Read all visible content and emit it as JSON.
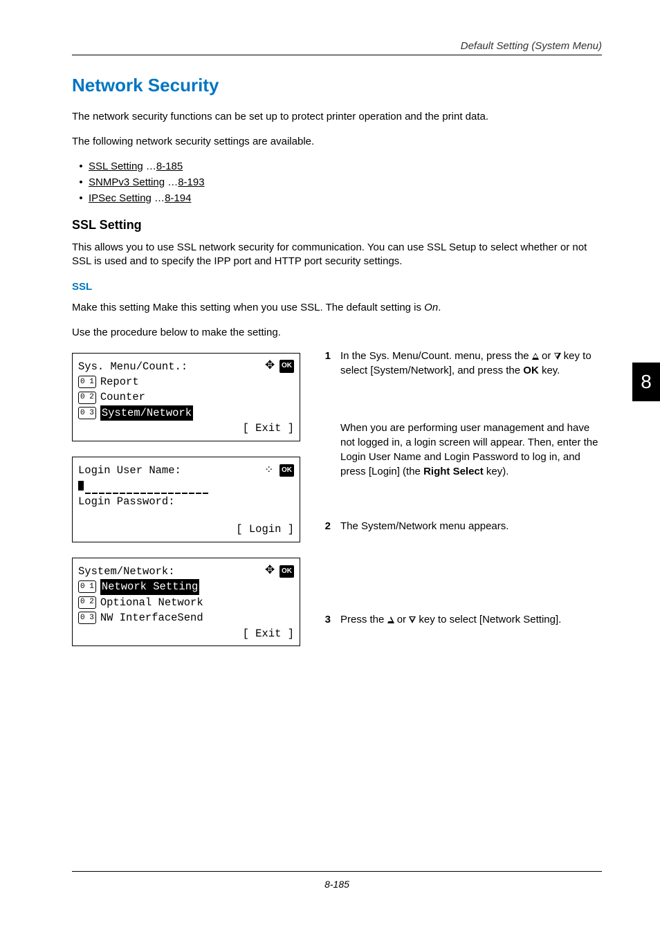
{
  "header": {
    "breadcrumb": "Default Setting (System Menu)"
  },
  "title": "Network Security",
  "intro1": "The network security functions can be set up to protect printer operation and the print data.",
  "intro2": "The following network security settings are available.",
  "bullets": {
    "b1a": "SSL Setting",
    "b1b": " …",
    "b1c": "8-185",
    "b2a": "SNMPv3 Setting",
    "b2b": " …",
    "b2c": "8-193",
    "b3a": "IPSec Setting",
    "b3b": " …",
    "b3c": "8-194"
  },
  "sslSetting": {
    "heading": "SSL Setting",
    "para": "This allows you to use SSL network security for communication. You can use SSL Setup to select whether or not SSL is used and to specify the IPP port and HTTP port security settings."
  },
  "ssl": {
    "heading": "SSL",
    "p1a": "Make this setting Make this setting when you use SSL. The default setting is ",
    "p1b": "On",
    "p1c": ".",
    "p2": "Use the procedure below to make the setting."
  },
  "lcd1": {
    "title": "Sys. Menu/Count.:",
    "n1": "0 1",
    "l1": "Report",
    "n2": "0 2",
    "l2": "Counter",
    "n3": "0 3",
    "l3": "System/Network",
    "exit": "[  Exit  ]",
    "ok": "OK"
  },
  "lcd2": {
    "title": "Login User Name:",
    "pw": "Login Password:",
    "login": "[ Login  ]",
    "ok": "OK"
  },
  "lcd3": {
    "title": "System/Network:",
    "n1": "0 1",
    "l1": "Network Setting",
    "n2": "0 2",
    "l2": "Optional Network",
    "n3": "0 3",
    "l3": "NW InterfaceSend",
    "exit": "[  Exit  ]",
    "ok": "OK"
  },
  "steps": {
    "s1n": "1",
    "s1a": "In the Sys. Menu/Count. menu, press the ",
    "s1b": " or ",
    "s1c": " key to select [System/Network], and press the ",
    "s1d": "OK",
    "s1e": " key.",
    "s1fa": "When you are performing user management and have not logged in, a login screen will appear. Then, enter the Login User Name and Login Password to log in, and press [Login] (the ",
    "s1fb": "Right Select",
    "s1fc": " key).",
    "s2n": "2",
    "s2t": "The System/Network menu appears.",
    "s3n": "3",
    "s3a": "Press the ",
    "s3b": " or ",
    "s3c": " key to select [Network Setting]."
  },
  "sideTab": "8",
  "pageNum": "8-185"
}
